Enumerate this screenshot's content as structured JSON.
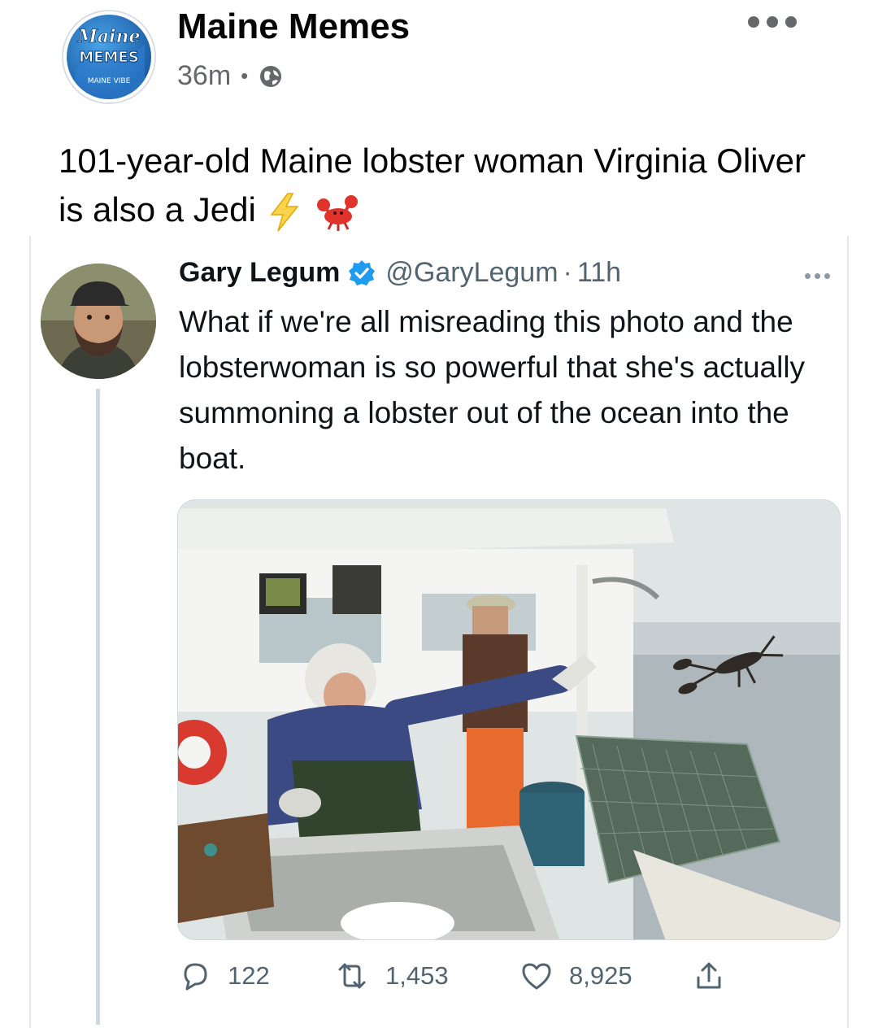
{
  "post": {
    "page_name": "Maine Memes",
    "timestamp": "36m",
    "separator": "•",
    "visibility_icon": "globe-icon",
    "more_icon": "more-horizontal-icon",
    "caption": "101-year-old Maine lobster woman Virginia Oliver is also a Jedi",
    "caption_emojis": [
      "lightning-icon",
      "lobster-icon"
    ],
    "avatar_logo": {
      "line1": "Maine",
      "line2": "MEMES",
      "line3": "MAINE VIBE"
    }
  },
  "tweet": {
    "author_name": "Gary Legum",
    "verified_icon": "verified-badge-icon",
    "handle": "@GaryLegum",
    "separator": "·",
    "time": "11h",
    "more_icon": "more-horizontal-icon",
    "text": "What if we're all misreading this photo and the lobsterwoman is so powerful that she's actually summoning a lobster out of the ocean into the boat.",
    "actions": {
      "replies": "122",
      "retweets": "1,453",
      "likes": "8,925"
    }
  },
  "colors": {
    "text_primary": "#050505",
    "text_secondary": "#65676b",
    "twitter_blue": "#1d9bf0",
    "twitter_gray": "#536471"
  }
}
